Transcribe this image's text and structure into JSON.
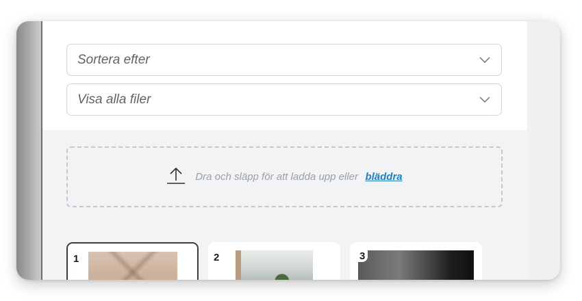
{
  "filters": {
    "sort_label": "Sortera efter",
    "show_label": "Visa alla filer",
    "chevron_icon": "chevron-down-icon"
  },
  "upload": {
    "icon": "upload-arrow-icon",
    "prompt": "Dra och släpp för att ladda upp eller",
    "browse_link": "bläddra",
    "link_color": "#1f7fc0"
  },
  "gallery": {
    "items": [
      {
        "number": "1",
        "selected": true
      },
      {
        "number": "2",
        "selected": false
      },
      {
        "number": "3",
        "selected": false
      }
    ]
  }
}
